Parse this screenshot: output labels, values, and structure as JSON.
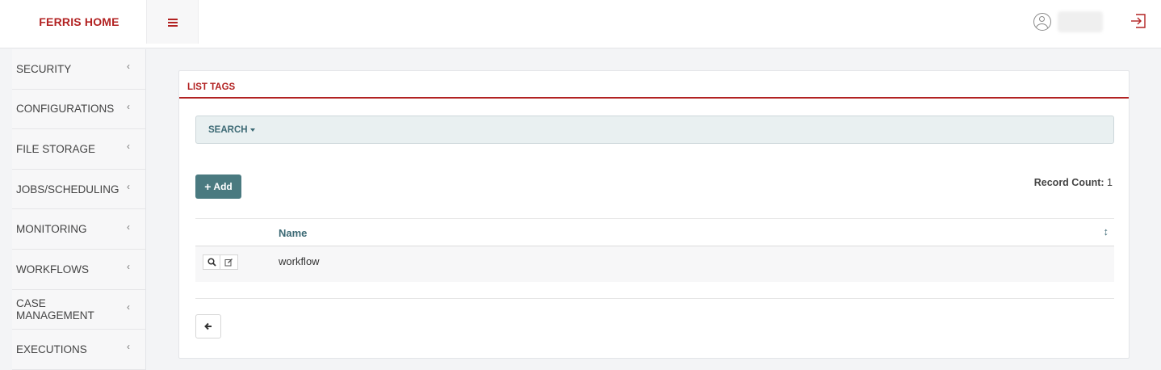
{
  "header": {
    "brand": "FERRIS HOME",
    "menu_icon": "hamburger-menu-icon",
    "user_icon": "user-circle-icon",
    "logout_icon": "sign-out-icon",
    "accent_color": "#b22222"
  },
  "sidebar": {
    "items": [
      {
        "label": "SECURITY"
      },
      {
        "label": "CONFIGURATIONS"
      },
      {
        "label": "FILE STORAGE"
      },
      {
        "label": "JOBS/SCHEDULING"
      },
      {
        "label": "MONITORING"
      },
      {
        "label": "WORKFLOWS"
      },
      {
        "label": "CASE MANAGEMENT"
      },
      {
        "label": "EXECUTIONS"
      }
    ]
  },
  "main": {
    "title": "LIST TAGS",
    "search_label": "SEARCH",
    "add_label": "Add",
    "record_count_label": "Record Count:",
    "record_count_value": "1",
    "table": {
      "columns": [
        "Name"
      ],
      "rows": [
        {
          "name": "workflow"
        }
      ]
    }
  }
}
